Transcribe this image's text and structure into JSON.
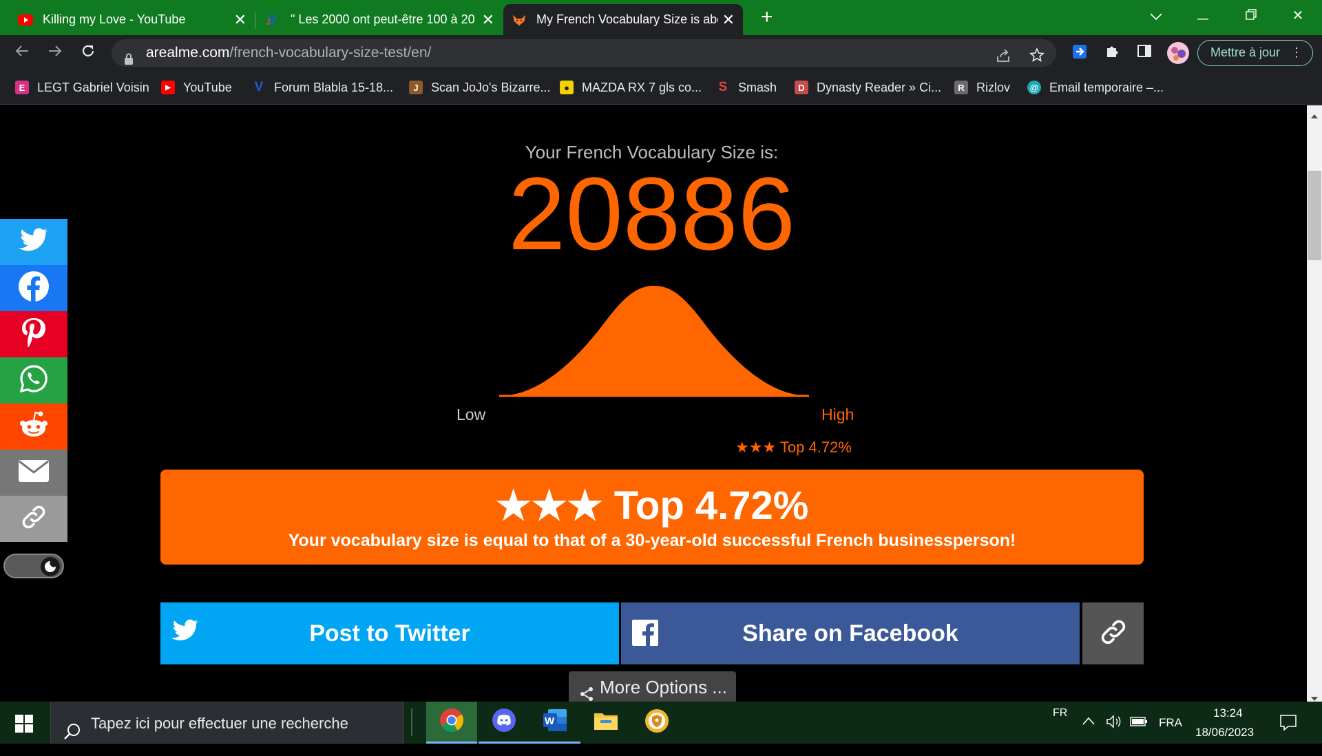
{
  "tabs": [
    {
      "title": "Killing my Love - YouTube",
      "icon": "youtube-icon"
    },
    {
      "title": "\" Les 2000 ont peut-être 100 à 20",
      "icon": "jvc-icon"
    },
    {
      "title": "My French Vocabulary Size is abo",
      "icon": "fox-icon"
    }
  ],
  "address": {
    "domain": "arealme.com",
    "path": "/french-vocabulary-size-test/en/"
  },
  "update_button": "Mettre à jour",
  "bookmarks": [
    {
      "label": "LEGT Gabriel Voisin",
      "color": "#d63384",
      "glyph": "E"
    },
    {
      "label": "YouTube",
      "color": "#ff0000",
      "glyph": "▶"
    },
    {
      "label": "Forum Blabla 15-18...",
      "color": "#1e5bd6",
      "glyph": "V"
    },
    {
      "label": "Scan JoJo's Bizarre...",
      "color": "#8a5a2b",
      "glyph": "J"
    },
    {
      "label": "MAZDA RX 7 gls co...",
      "color": "#f2d200",
      "glyph": "●"
    },
    {
      "label": "Smash",
      "color": "#e8453c",
      "glyph": "S"
    },
    {
      "label": "Dynasty Reader » Ci...",
      "color": "#c94b4b",
      "glyph": "D"
    },
    {
      "label": "Rizlov",
      "color": "#6b6b6b",
      "glyph": "R"
    },
    {
      "label": "Email temporaire –...",
      "color": "#1fa9b8",
      "glyph": "@"
    }
  ],
  "result": {
    "heading": "Your French Vocabulary Size is:",
    "score": "20886",
    "low_label": "Low",
    "high_label": "High",
    "rank_small": "★★★ Top 4.72%",
    "banner_title": "★★★ Top 4.72%",
    "banner_subtitle": "Your vocabulary size is equal to that of a 30-year-old successful French businessperson!",
    "accent": "#ff6600"
  },
  "share": {
    "twitter": "Post to Twitter",
    "facebook": "Share on Facebook",
    "more": "More Options ..."
  },
  "social_rail": [
    {
      "name": "twitter",
      "color": "#1da1f2"
    },
    {
      "name": "facebook",
      "color": "#1877f2"
    },
    {
      "name": "pinterest",
      "color": "#e60023"
    },
    {
      "name": "whatsapp",
      "color": "#25a244"
    },
    {
      "name": "reddit",
      "color": "#ff4500"
    },
    {
      "name": "email",
      "color": "#777777"
    },
    {
      "name": "link",
      "color": "#9a9a9a"
    }
  ],
  "taskbar": {
    "search_placeholder": "Tapez ici pour effectuer une recherche",
    "lang_top": "FR",
    "lang": "FRA",
    "time": "13:24",
    "date": "18/06/2023"
  }
}
